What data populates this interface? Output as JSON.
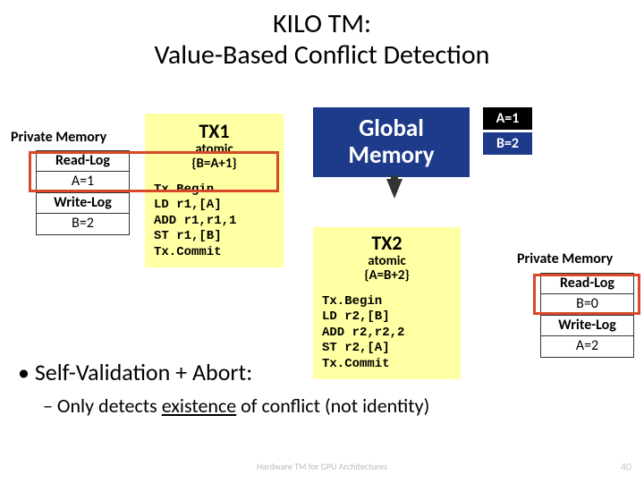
{
  "title_line1": "KILO TM:",
  "title_line2": "Value-Based Conflict Detection",
  "pm_left": {
    "label": "Private Memory",
    "read_log": "Read-Log",
    "read_val": "A=1",
    "write_log": "Write-Log",
    "write_val": "B=2"
  },
  "pm_right": {
    "label": "Private Memory",
    "read_log": "Read-Log",
    "read_val": "B=0",
    "write_log": "Write-Log",
    "write_val": "A=2"
  },
  "tx1": {
    "name": "TX1",
    "atomic1": "atomic",
    "atomic2": "{B=A+1}",
    "code": "Tx.Begin\nLD r1,[A]\nADD r1,r1,1\nST r1,[B]\nTx.Commit"
  },
  "tx2": {
    "name": "TX2",
    "atomic1": "atomic",
    "atomic2": "{A=B+2}",
    "code": "Tx.Begin\nLD r2,[B]\nADD r2,r2,2\nST r2,[A]\nTx.Commit"
  },
  "global_memory": "Global\nMemory",
  "gm_vals": {
    "a": "A=1",
    "b": "B=2"
  },
  "bullet1": "• Self-Validation + Abort:",
  "bullet2_pre": "– Only detects ",
  "bullet2_u": "existence",
  "bullet2_post": " of conflict (not identity)",
  "footer": "Hardware TM for GPU Architectures",
  "page": "40"
}
